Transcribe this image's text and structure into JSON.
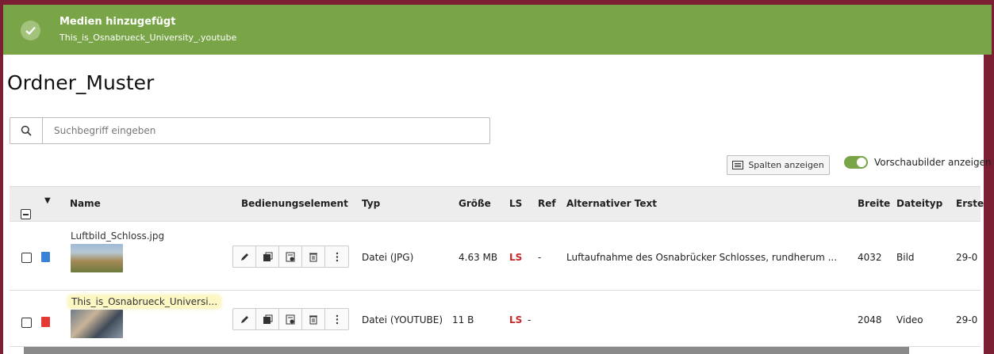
{
  "notification": {
    "title": "Medien hinzugefügt",
    "message": "This_is_Osnabrueck_University_.youtube",
    "color": "#79a548"
  },
  "page": {
    "title": "Ordner_Muster"
  },
  "search": {
    "placeholder": "Suchbegriff eingeben"
  },
  "toolbar": {
    "columns_label": "Spalten anzeigen",
    "thumbnails_label": "Vorschaubilder anzeigen",
    "thumbnails_on": true
  },
  "table": {
    "headers": {
      "name": "Name",
      "control": "Bedienungselement",
      "type": "Typ",
      "size": "Größe",
      "ls": "LS",
      "ref": "Ref",
      "alt": "Alternativer Text",
      "width": "Breite",
      "filetype": "Dateityp",
      "created": "Erste"
    },
    "rows": [
      {
        "name": "Luftbild_Schloss.jpg",
        "type": "Datei (JPG)",
        "size": "4.63 MB",
        "ls": "LS",
        "ref": "-",
        "alt": "Luftaufnahme des Osnabrücker Schlosses, rundherum ...",
        "width": "4032",
        "filetype": "Bild",
        "created": "29-0",
        "icon": "image-file-icon"
      },
      {
        "name": "This_is_Osnabrueck_Universi...",
        "type": "Datei (YOUTUBE)",
        "size": "11 B",
        "ls": "LS",
        "ref": "-",
        "alt": "",
        "width": "2048",
        "filetype": "Video",
        "created": "29-0",
        "icon": "video-file-icon"
      }
    ]
  }
}
